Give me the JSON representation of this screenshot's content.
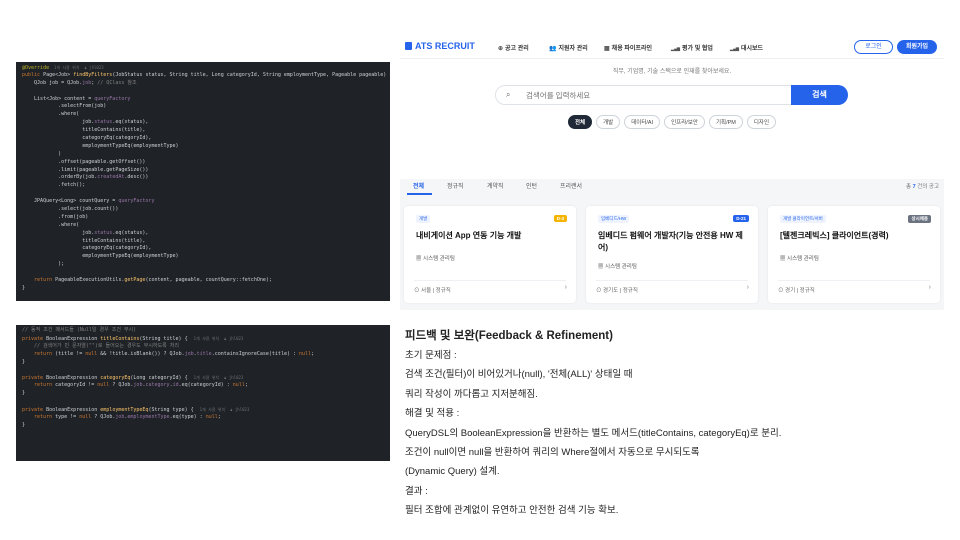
{
  "code1": {
    "lines": [
      [
        [
          "@Override",
          "a"
        ],
        [
          "  1개 사용 위치  ",
          "h"
        ],
        [
          "♟ jhl023",
          "h"
        ]
      ],
      [
        [
          "public ",
          "k"
        ],
        [
          "Page<Job> ",
          ""
        ],
        [
          "findByFilters",
          "f"
        ],
        [
          "(JobStatus status, String title, Long categoryId, String employmentType, Pageable pageable) {",
          ""
        ]
      ],
      [
        [
          "    QJob job = QJob.",
          ""
        ],
        [
          "job",
          "p"
        ],
        [
          "; ",
          ""
        ],
        [
          "// QClass 참조",
          "c"
        ]
      ],
      [
        [
          "",
          ""
        ]
      ],
      [
        [
          "    List<Job> content = ",
          ""
        ],
        [
          "queryFactory",
          "p"
        ]
      ],
      [
        [
          "            .selectFrom(job)",
          ""
        ]
      ],
      [
        [
          "            .where(",
          ""
        ]
      ],
      [
        [
          "                    job.",
          ""
        ],
        [
          "status",
          "p"
        ],
        [
          ".eq(status),",
          ""
        ]
      ],
      [
        [
          "                    titleContains(title),",
          ""
        ]
      ],
      [
        [
          "                    categoryEq(categoryId),",
          ""
        ]
      ],
      [
        [
          "                    employmentTypeEq(employmentType)",
          ""
        ]
      ],
      [
        [
          "            )",
          ""
        ]
      ],
      [
        [
          "            .offset(pageable.getOffset())",
          ""
        ]
      ],
      [
        [
          "            .limit(pageable.getPageSize())",
          ""
        ]
      ],
      [
        [
          "            .orderBy(job.",
          ""
        ],
        [
          "createdAt",
          "p"
        ],
        [
          ".desc())",
          ""
        ]
      ],
      [
        [
          "            .fetch();",
          ""
        ]
      ],
      [
        [
          "",
          ""
        ]
      ],
      [
        [
          "    JPAQuery<Long> countQuery = ",
          ""
        ],
        [
          "queryFactory",
          "p"
        ]
      ],
      [
        [
          "            .select(job.count())",
          ""
        ]
      ],
      [
        [
          "            .from(job)",
          ""
        ]
      ],
      [
        [
          "            .where(",
          ""
        ]
      ],
      [
        [
          "                    job.",
          ""
        ],
        [
          "status",
          "p"
        ],
        [
          ".eq(status),",
          ""
        ]
      ],
      [
        [
          "                    titleContains(title),",
          ""
        ]
      ],
      [
        [
          "                    categoryEq(categoryId),",
          ""
        ]
      ],
      [
        [
          "                    employmentTypeEq(employmentType)",
          ""
        ]
      ],
      [
        [
          "            );",
          ""
        ]
      ],
      [
        [
          "",
          ""
        ]
      ],
      [
        [
          "    return ",
          "k"
        ],
        [
          "PageableExecutionUtils.",
          ""
        ],
        [
          "getPage",
          "f"
        ],
        [
          "(content, pageable, countQuery::fetchOne);",
          ""
        ]
      ],
      [
        [
          "}",
          ""
        ]
      ]
    ]
  },
  "code2": {
    "lines": [
      [
        [
          "// 동적 조건 메서드들 (Null일 경우 조건 무시)",
          "c"
        ]
      ],
      [
        [
          "private ",
          "k"
        ],
        [
          "BooleanExpression ",
          ""
        ],
        [
          "titleContains",
          "f"
        ],
        [
          "(String title) {  ",
          ""
        ],
        [
          "1개 사용 위치  ♟ jhl023",
          "h"
        ]
      ],
      [
        [
          "    // 검색어가 빈 문자열(\"\")로 들어오는 경우도 무시하도록 처리",
          "c"
        ]
      ],
      [
        [
          "    return ",
          "k"
        ],
        [
          "(title != ",
          ""
        ],
        [
          "null ",
          "k"
        ],
        [
          "&& !title.isBlank()) ? QJob.",
          ""
        ],
        [
          "job",
          "p"
        ],
        [
          ".",
          ""
        ],
        [
          "title",
          "p"
        ],
        [
          ".containsIgnoreCase(title) : ",
          ""
        ],
        [
          "null",
          "k"
        ],
        [
          ";",
          ""
        ]
      ],
      [
        [
          "}",
          ""
        ]
      ],
      [
        [
          "",
          ""
        ]
      ],
      [
        [
          "private ",
          "k"
        ],
        [
          "BooleanExpression ",
          ""
        ],
        [
          "categoryEq",
          "f"
        ],
        [
          "(Long categoryId) {  ",
          ""
        ],
        [
          "1개 사용 위치  ♟ jhl023",
          "h"
        ]
      ],
      [
        [
          "    return ",
          "k"
        ],
        [
          "categoryId != ",
          ""
        ],
        [
          "null ",
          "k"
        ],
        [
          "? QJob.",
          ""
        ],
        [
          "job",
          "p"
        ],
        [
          ".",
          ""
        ],
        [
          "category",
          "p"
        ],
        [
          ".",
          ""
        ],
        [
          "id",
          "p"
        ],
        [
          ".eq(categoryId) : ",
          ""
        ],
        [
          "null",
          "k"
        ],
        [
          ";",
          ""
        ]
      ],
      [
        [
          "}",
          ""
        ]
      ],
      [
        [
          "",
          ""
        ]
      ],
      [
        [
          "private ",
          "k"
        ],
        [
          "BooleanExpression ",
          ""
        ],
        [
          "employmentTypeEq",
          "f"
        ],
        [
          "(String type) {  ",
          ""
        ],
        [
          "1개 사용 위치  ♟ jhl023",
          "h"
        ]
      ],
      [
        [
          "    return ",
          "k"
        ],
        [
          "type != ",
          ""
        ],
        [
          "null ",
          "k"
        ],
        [
          "? QJob.",
          ""
        ],
        [
          "job",
          "p"
        ],
        [
          ".",
          ""
        ],
        [
          "employmentType",
          "p"
        ],
        [
          ".eq(type) : ",
          ""
        ],
        [
          "null",
          "k"
        ],
        [
          ";",
          ""
        ]
      ],
      [
        [
          "}",
          ""
        ]
      ]
    ]
  },
  "app": {
    "logo": "ATS RECRUIT",
    "menu": [
      {
        "icon": "⊕",
        "label": "공고 관리"
      },
      {
        "icon": "👥",
        "label": "지원자 관리"
      },
      {
        "icon": "▦",
        "label": "채용 파이프라인"
      },
      {
        "icon": "▂▄▆",
        "label": "평가 및 협업"
      },
      {
        "icon": "▂▄▆",
        "label": "대시보드"
      }
    ],
    "login": "로그인",
    "join": "회원가입",
    "subtitle": "직무, 기업명, 기술 스택으로 인재를 찾아보세요.",
    "search_placeholder": "검색어를 입력하세요",
    "search_button": "검색",
    "chips": [
      "전체",
      "개발",
      "데이터/AI",
      "인프라/보안",
      "기획/PM",
      "디자인"
    ],
    "tabs": [
      "전체",
      "정규직",
      "계약직",
      "인턴",
      "프리랜서"
    ],
    "total_prefix": "총 ",
    "total_count": "7",
    "total_suffix": " 건의 공고",
    "cards": [
      {
        "tag": "개발",
        "dday": "D-3",
        "dday_bg": "#f5b400",
        "dday_fg": "#ffffff",
        "title": "내비게이션 App 연동 기능 개발",
        "company": "시스템 관리팀",
        "meta": "서울 | 정규직"
      },
      {
        "tag": "임베디드/HW",
        "dday": "D-21",
        "dday_bg": "#2563eb",
        "dday_fg": "#ffffff",
        "title": "임베디드 펌웨어 개발자(기능 안전용 HW 제어)",
        "company": "시스템 관리팀",
        "meta": "경기도 | 정규직"
      },
      {
        "tag": "개발 클라이언트/서버",
        "dday": "상시채용",
        "dday_bg": "#6b7280",
        "dday_fg": "#ffffff",
        "title": "[텔젠크레빅스] 클라이언트(경력)",
        "company": "시스템 관리팀",
        "meta": "경기 | 정규직"
      }
    ]
  },
  "notes": {
    "title": "피드백 및 보완(Feedback & Refinement)",
    "lines": [
      "초기 문제점 :",
      "검색 조건(필터)이 비어있거나(null), '전체(ALL)' 상태일 때",
      "쿼리 작성이 까다롭고 지저분해짐.",
      "해결 및 적용 :",
      "QueryDSL의 BooleanExpression을 반환하는 별도 메서드(titleContains, categoryEq)로 분리.",
      "조건이 null이면 null을 반환하여 쿼리의 Where절에서 자동으로 무시되도록",
      "(Dynamic Query) 설계.",
      "결과 :",
      "필터 조합에 관계없이 유연하고 안전한 검색 기능 확보."
    ]
  }
}
